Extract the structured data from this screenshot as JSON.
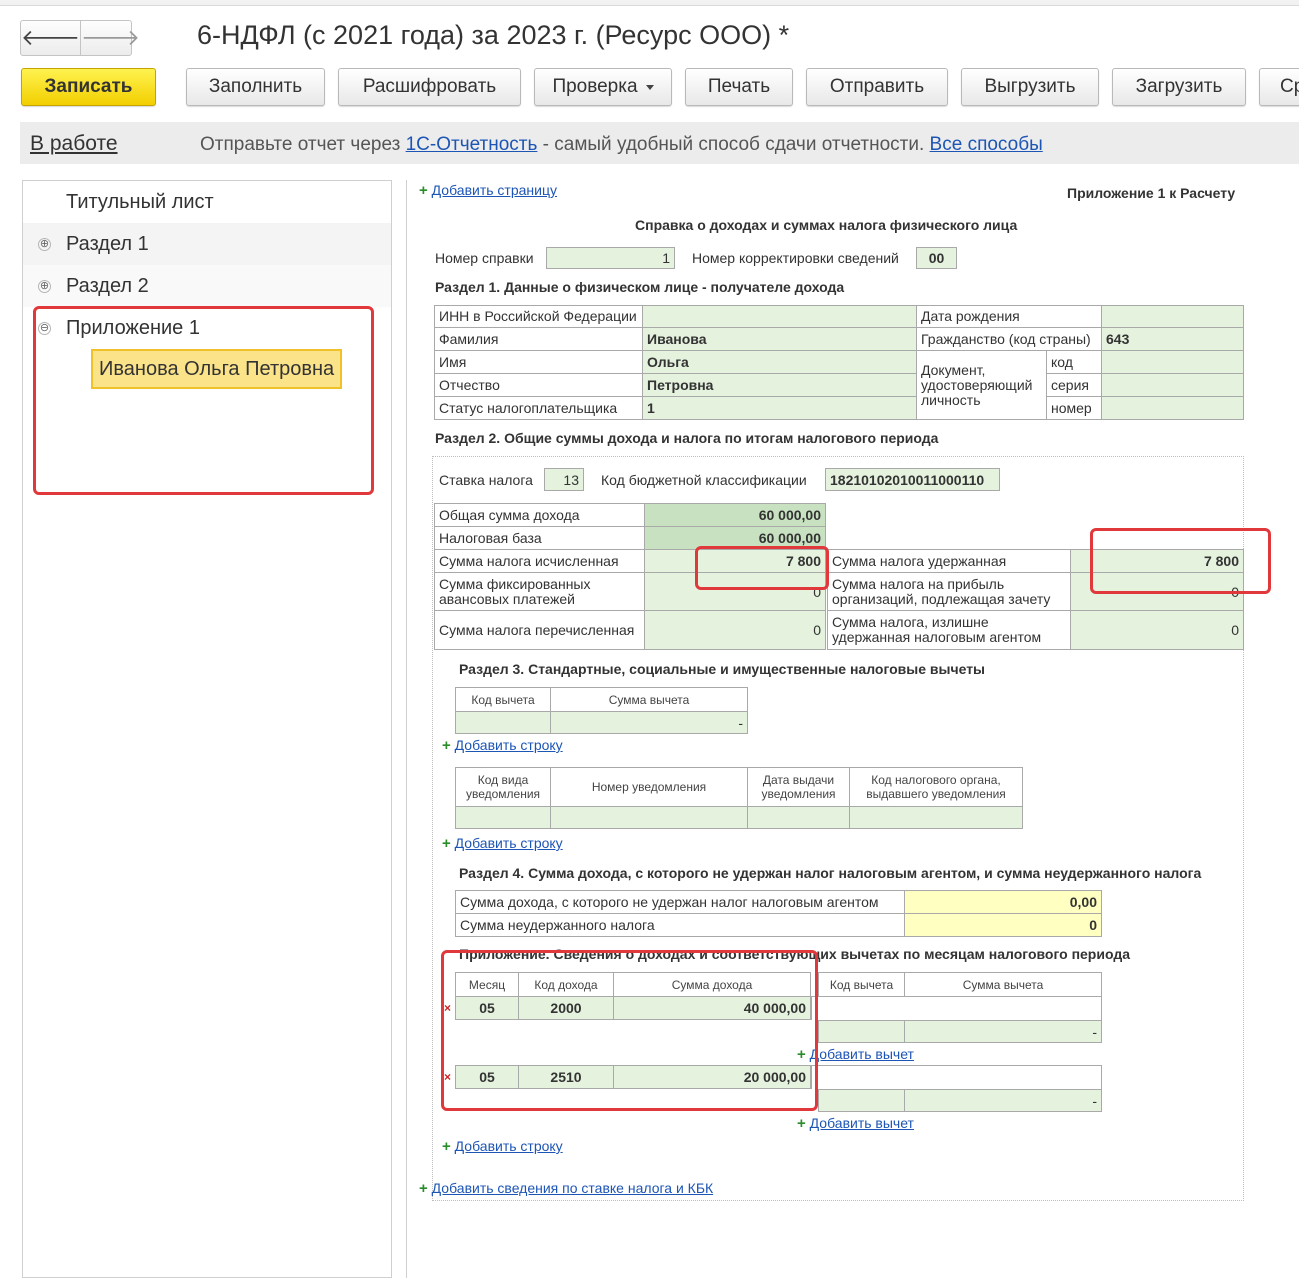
{
  "window": {
    "title": "6-НДФЛ (с 2021 года) за 2023 г. (Ресурс ООО) *"
  },
  "nav_icons": {
    "back": "arrow-left-icon",
    "forward": "arrow-right-icon"
  },
  "toolbar": {
    "save": "Записать",
    "fill": "Заполнить",
    "decode": "Расшифровать",
    "check": "Проверка",
    "print": "Печать",
    "send": "Отправить",
    "export": "Выгрузить",
    "import": "Загрузить",
    "more": "Ср"
  },
  "status": {
    "state": "В работе",
    "text_before": "Отправьте отчет через ",
    "link": "1С-Отчетность",
    "text_after": " - самый удобный способ сдачи отчетности. ",
    "all_ways": "Все способы"
  },
  "tree": {
    "title_sheet": "Титульный лист",
    "section1": "Раздел 1",
    "section2": "Раздел 2",
    "appendix1": "Приложение 1",
    "person": "Иванова Ольга Петровна",
    "plus": "⊕",
    "minus": "⊖"
  },
  "form": {
    "add_page": "Добавить страницу",
    "appendix_title": "Приложение 1 к Расчету",
    "certificate_title": "Справка о доходах и суммах налога физического лица",
    "cert_number_label": "Номер справки",
    "cert_number": "1",
    "correction_label": "Номер корректировки сведений",
    "correction": "00",
    "section1": {
      "title": "Раздел 1. Данные о физическом лице - получателе дохода",
      "inn_label": "ИНН в Российской Федерации",
      "inn": "",
      "surname_label": "Фамилия",
      "surname": "Иванова",
      "name_label": "Имя",
      "name": "Ольга",
      "patronymic_label": "Отчество",
      "patronymic": "Петровна",
      "status_label": "Статус налогоплательщика",
      "status": "1",
      "birth_label": "Дата рождения",
      "birth": "",
      "citizenship_label": "Гражданство (код страны)",
      "citizenship": "643",
      "doc_label": "Документ, удостоверяющий личность",
      "doc_code_label": "код",
      "doc_series_label": "серия",
      "doc_number_label": "номер"
    },
    "section2": {
      "title": "Раздел 2. Общие суммы дохода и налога по итогам налогового периода",
      "rate_label": "Ставка налога",
      "rate": "13",
      "kbk_label": "Код бюджетной классификации",
      "kbk": "18210102010011000110",
      "total_income_label": "Общая сумма дохода",
      "total_income": "60 000,00",
      "tax_base_label": "Налоговая база",
      "tax_base": "60 000,00",
      "tax_calc_label": "Сумма налога исчисленная",
      "tax_calc": "7 800",
      "fixed_adv_label": "Сумма фиксированных авансовых платежей",
      "fixed_adv": "0",
      "tax_paid_label": "Сумма налога перечисленная",
      "tax_paid": "0",
      "tax_withheld_label": "Сумма налога удержанная",
      "tax_withheld": "7 800",
      "profit_tax_label": "Сумма налога на прибыль организаций, подлежащая зачету",
      "profit_tax": "0",
      "excess_label": "Сумма налога, излишне удержанная налоговым агентом",
      "excess": "0"
    },
    "section3": {
      "title": "Раздел 3. Стандартные, социальные и имущественные налоговые вычеты",
      "ded_code_header": "Код вычета",
      "ded_sum_header": "Сумма вычета",
      "ded_sum": "-",
      "add_row": "Добавить строку",
      "notif_type_header": "Код вида уведомления",
      "notif_number_header": "Номер уведомления",
      "notif_date_header": "Дата выдачи уведомления",
      "notif_authority_header": "Код налогового органа, выдавшего уведомления",
      "add_row2": "Добавить строку"
    },
    "section4": {
      "title": "Раздел 4. Сумма дохода, с которого не удержан налог налоговым агентом, и сумма неудержанного налога",
      "income_label": "Сумма дохода, с которого не удержан налог налоговым агентом",
      "income": "0,00",
      "tax_label": "Сумма неудержанного налога",
      "tax": "0"
    },
    "appendix": {
      "title": "Приложение. Сведения о доходах и соответствующих вычетах по месяцам налогового периода",
      "month_header": "Месяц",
      "income_code_header": "Код дохода",
      "income_sum_header": "Сумма дохода",
      "ded_code_header": "Код вычета",
      "ded_sum_header": "Сумма вычета",
      "rows": [
        {
          "month": "05",
          "code": "2000",
          "sum": "40 000,00",
          "ded_sum": "-",
          "add_ded": "Добавить вычет"
        },
        {
          "month": "05",
          "code": "2510",
          "sum": "20 000,00",
          "ded_sum": "-",
          "add_ded": "Добавить вычет"
        }
      ],
      "delete_mark": "×",
      "add_row": "Добавить строку"
    },
    "add_rate_kbk": "Добавить сведения по ставке налога и КБК",
    "plus_sign": "+"
  }
}
